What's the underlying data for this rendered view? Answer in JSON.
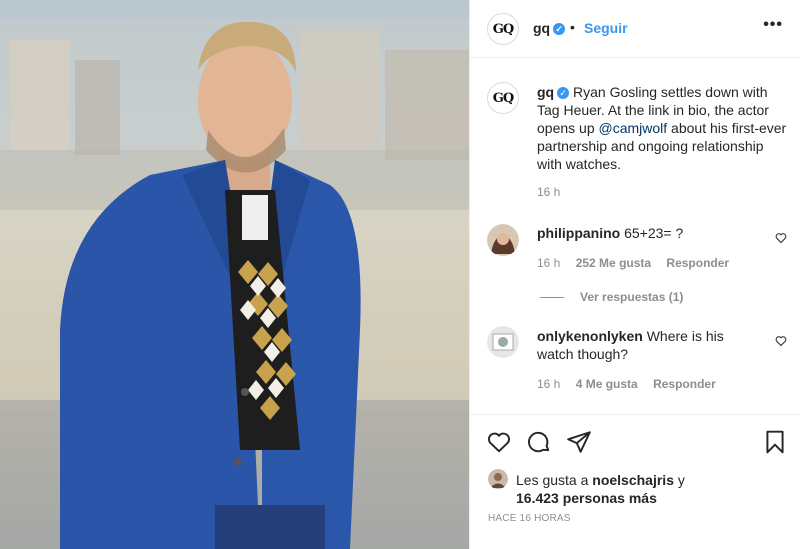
{
  "header": {
    "avatar_text": "GQ",
    "username": "gq",
    "verified_icon": "verified-badge-icon",
    "separator": "•",
    "follow_label": "Seguir",
    "more_label": "•••"
  },
  "caption": {
    "avatar_text": "GQ",
    "username": "gq",
    "text_before": "Ryan Gosling settles down with Tag Heuer. At the link in bio, the actor opens up ",
    "mention": "@camjwolf",
    "text_after": " about his first-ever partnership and ongoing relationship with watches.",
    "time": "16 h"
  },
  "comments": [
    {
      "username": "philippanino",
      "text": "65+23= ?",
      "time": "16 h",
      "likes": "252 Me gusta",
      "reply_label": "Responder",
      "view_replies": "Ver respuestas (1)"
    },
    {
      "username": "onlykenonlyken",
      "text": "Where is his watch though?",
      "time": "16 h",
      "likes": "4 Me gusta",
      "reply_label": "Responder"
    }
  ],
  "liked_by": {
    "prefix": "Les gusta a",
    "user": "noelschajris",
    "connector": "y",
    "others": "16.423 personas más"
  },
  "posted_time": "HACE 16 HORAS",
  "colors": {
    "link_blue": "#3897f0",
    "text": "#262626",
    "muted": "#8e8e8e",
    "jacket_blue": "#2a55a8"
  }
}
